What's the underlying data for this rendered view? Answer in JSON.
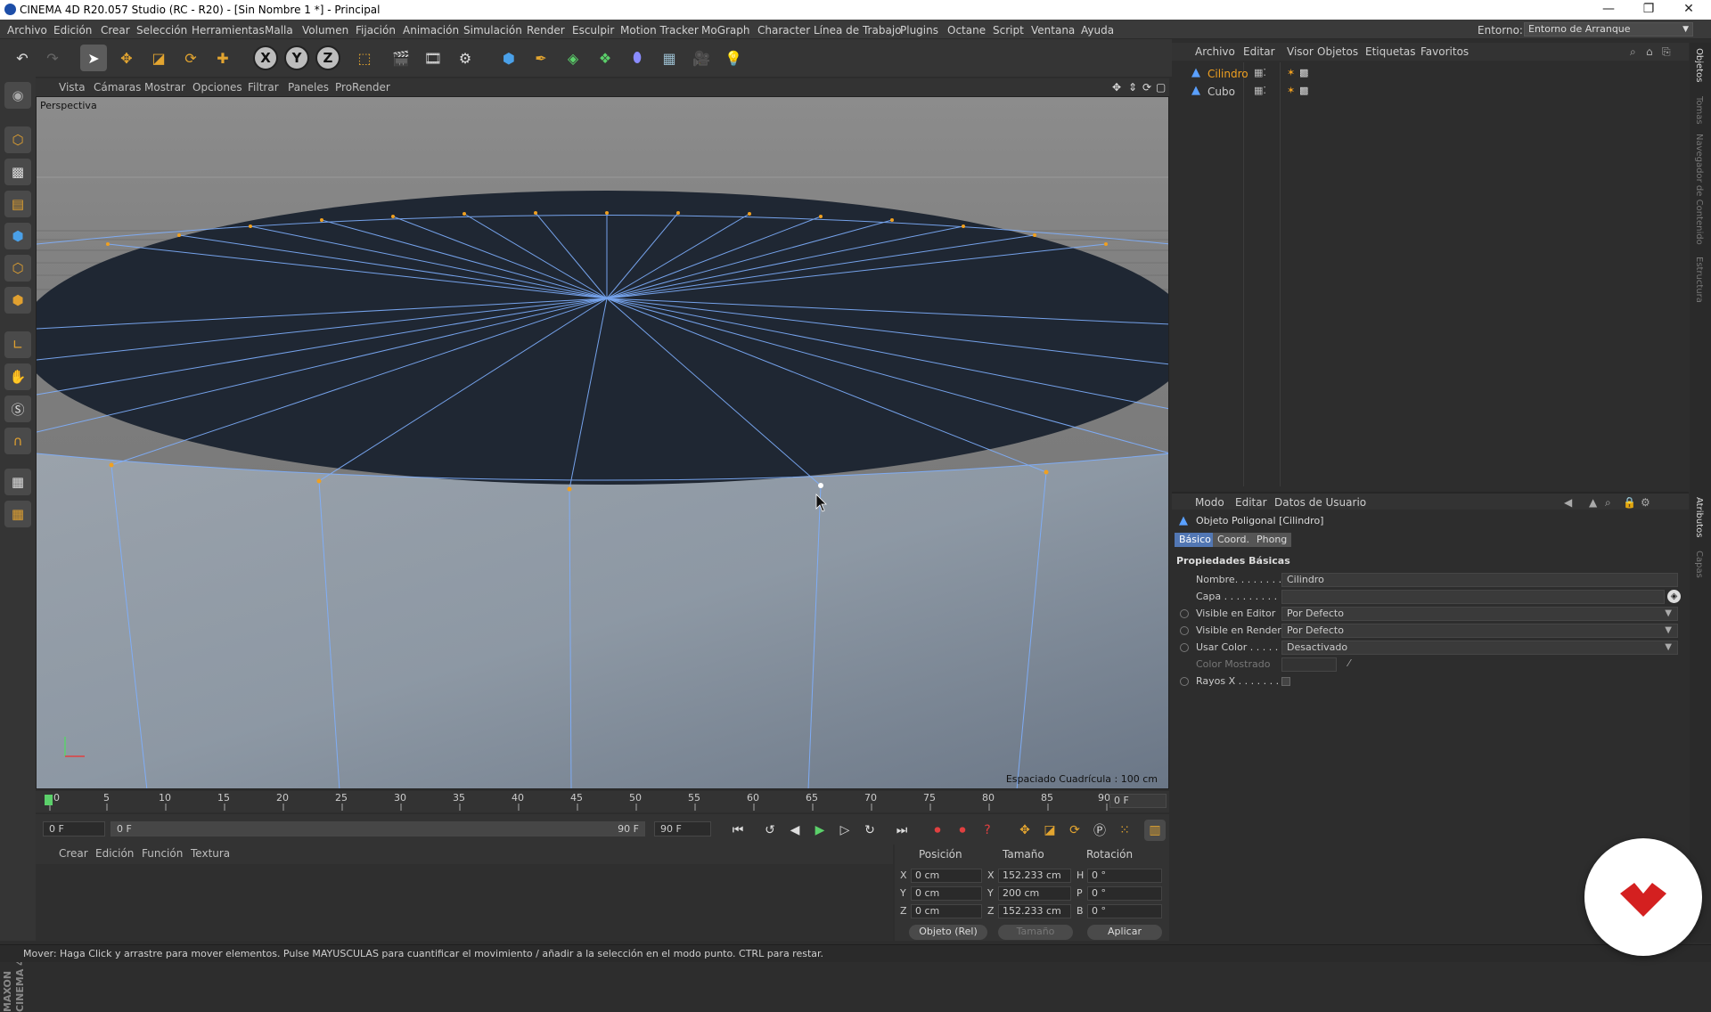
{
  "window": {
    "title": "CINEMA 4D R20.057 Studio (RC - R20) - [Sin Nombre 1 *] - Principal",
    "minimize": "—",
    "restore": "❐",
    "close": "✕"
  },
  "menubar": {
    "items": [
      "Archivo",
      "Edición",
      "Crear",
      "Selección",
      "Herramientas",
      "Malla",
      "Volumen",
      "Fijación",
      "Animación",
      "Simulación",
      "Render",
      "Esculpir",
      "Motion Tracker",
      "MoGraph",
      "Character",
      "Línea de Trabajo",
      "Plugins",
      "Octane",
      "Script",
      "Ventana",
      "Ayuda"
    ],
    "environment_label": "Entorno:",
    "environment_value": "Entorno de Arranque"
  },
  "toolbar": {
    "axis_x": "X",
    "axis_y": "Y",
    "axis_z": "Z"
  },
  "viewport": {
    "menu": [
      "Vista",
      "Cámaras",
      "Mostrar",
      "Opciones",
      "Filtrar",
      "Paneles",
      "ProRender"
    ],
    "camera_label": "Perspectiva",
    "grid_info": "Espaciado Cuadrícula : 100 cm"
  },
  "timeline": {
    "ticks": [
      "0",
      "5",
      "10",
      "15",
      "20",
      "25",
      "30",
      "35",
      "40",
      "45",
      "50",
      "55",
      "60",
      "65",
      "70",
      "75",
      "80",
      "85",
      "90"
    ],
    "current_frame": "0 F",
    "start_field": "0 F",
    "range_start": "0 F",
    "range_end": "90 F",
    "end_field": "90 F"
  },
  "materials": {
    "menu": [
      "Crear",
      "Edición",
      "Función",
      "Textura"
    ]
  },
  "coordinates": {
    "headers": {
      "position": "Posición",
      "size": "Tamaño",
      "rotation": "Rotación"
    },
    "rows": [
      {
        "axis": "X",
        "pos": "0 cm",
        "size_axis": "X",
        "size": "152.233 cm",
        "rot_axis": "H",
        "rot": "0 °"
      },
      {
        "axis": "Y",
        "pos": "0 cm",
        "size_axis": "Y",
        "size": "200 cm",
        "rot_axis": "P",
        "rot": "0 °"
      },
      {
        "axis": "Z",
        "pos": "0 cm",
        "size_axis": "Z",
        "size": "152.233 cm",
        "rot_axis": "B",
        "rot": "0 °"
      }
    ],
    "mode_select": "Objeto (Rel)",
    "size_select": "Tamaño",
    "apply_button": "Aplicar"
  },
  "object_manager": {
    "menu": [
      "Archivo",
      "Editar",
      "Visor",
      "Objetos",
      "Etiquetas",
      "Favoritos"
    ],
    "objects": [
      {
        "name": "Cilindro",
        "selected": true
      },
      {
        "name": "Cubo",
        "selected": false
      }
    ]
  },
  "right_tabs": [
    "Objetos",
    "Tomas",
    "Navegador de Contenido",
    "Estructura",
    "Atributos",
    "Capas"
  ],
  "attributes": {
    "menu": [
      "Modo",
      "Editar",
      "Datos de Usuario"
    ],
    "object_title": "Objeto Poligonal [Cilindro]",
    "tabs": [
      "Básico",
      "Coord.",
      "Phong"
    ],
    "section": "Propiedades Básicas",
    "props": [
      {
        "label": "Nombre. . . . . . . .",
        "value": "Cilindro"
      },
      {
        "label": "Capa . . . . . . . . .",
        "value": ""
      },
      {
        "label": "Visible en Editor",
        "value": "Por Defecto"
      },
      {
        "label": "Visible en Render",
        "value": "Por Defecto"
      },
      {
        "label": "Usar Color . . . . .",
        "value": "Desactivado"
      },
      {
        "label": "Color Mostrado",
        "value": ""
      },
      {
        "label": "Rayos X . . . . . . .",
        "value": ""
      }
    ]
  },
  "status": {
    "text": "Mover: Haga Click y arrastre para mover elementos. Pulse MAYUSCULAS para cuantificar el movimiento / añadir a la selección en el modo punto. CTRL para restar."
  },
  "colors": {
    "accent_selection": "#5277b4",
    "selected_object": "#f0a020",
    "wire": "#7fb0ff",
    "badge_red": "#d42020"
  }
}
